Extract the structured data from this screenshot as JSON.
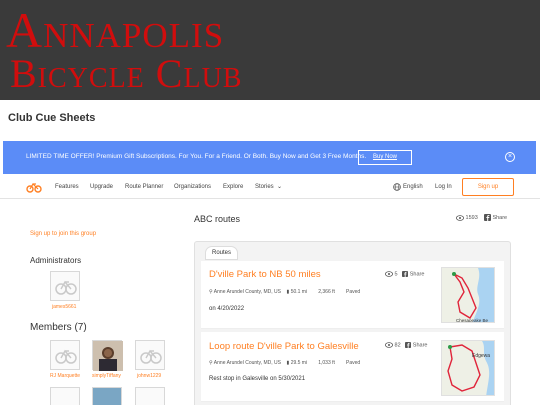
{
  "banner": {
    "line1": "Annapolis",
    "line2": "Bicycle Club"
  },
  "page_title": "Club Cue Sheets",
  "promo": {
    "text": "LIMITED TIME OFFER! Premium Gift Subscriptions. For You. For a Friend. Or Both. Buy Now and Get 3 Free Months.",
    "button": "Buy Now"
  },
  "nav": {
    "items": [
      "Features",
      "Upgrade",
      "Route Planner",
      "Organizations",
      "Explore",
      "Stories"
    ],
    "language": "English",
    "login": "Log In",
    "signup": "Sign up"
  },
  "sidebar": {
    "join": "Sign up to join this group",
    "admins_heading": "Administrators",
    "admins": [
      {
        "name": "james5661"
      }
    ],
    "members_heading": "Members (7)",
    "members": [
      {
        "name": "RJ Marquette"
      },
      {
        "name": "simplyTiffany"
      },
      {
        "name": "johnw1229"
      }
    ]
  },
  "main": {
    "title": "ABC routes",
    "views": "1593",
    "share": "Share",
    "tab": "Routes",
    "routes": [
      {
        "title": "D'ville Park to NB 50 miles",
        "views": "5",
        "share": "Share",
        "location": "Anne Arundel County, MD, US",
        "distance": "50.1 mi",
        "elevation": "2,366 ft",
        "surface": "Paved",
        "description": "on 4/20/2022",
        "map_label": "Chesapeake Be"
      },
      {
        "title": "Loop route D'ville Park to Galesville",
        "views": "82",
        "share": "Share",
        "location": "Anne Arundel County, MD, US",
        "distance": "29.5 mi",
        "elevation": "1,033 ft",
        "surface": "Paved",
        "description": "Rest stop in Galesville on 5/30/2021",
        "map_label": "Edgewa"
      }
    ]
  },
  "colors": {
    "brand_red": "#d10d0d",
    "accent_orange": "#ff7f22",
    "promo_blue": "#5b8cf7"
  }
}
